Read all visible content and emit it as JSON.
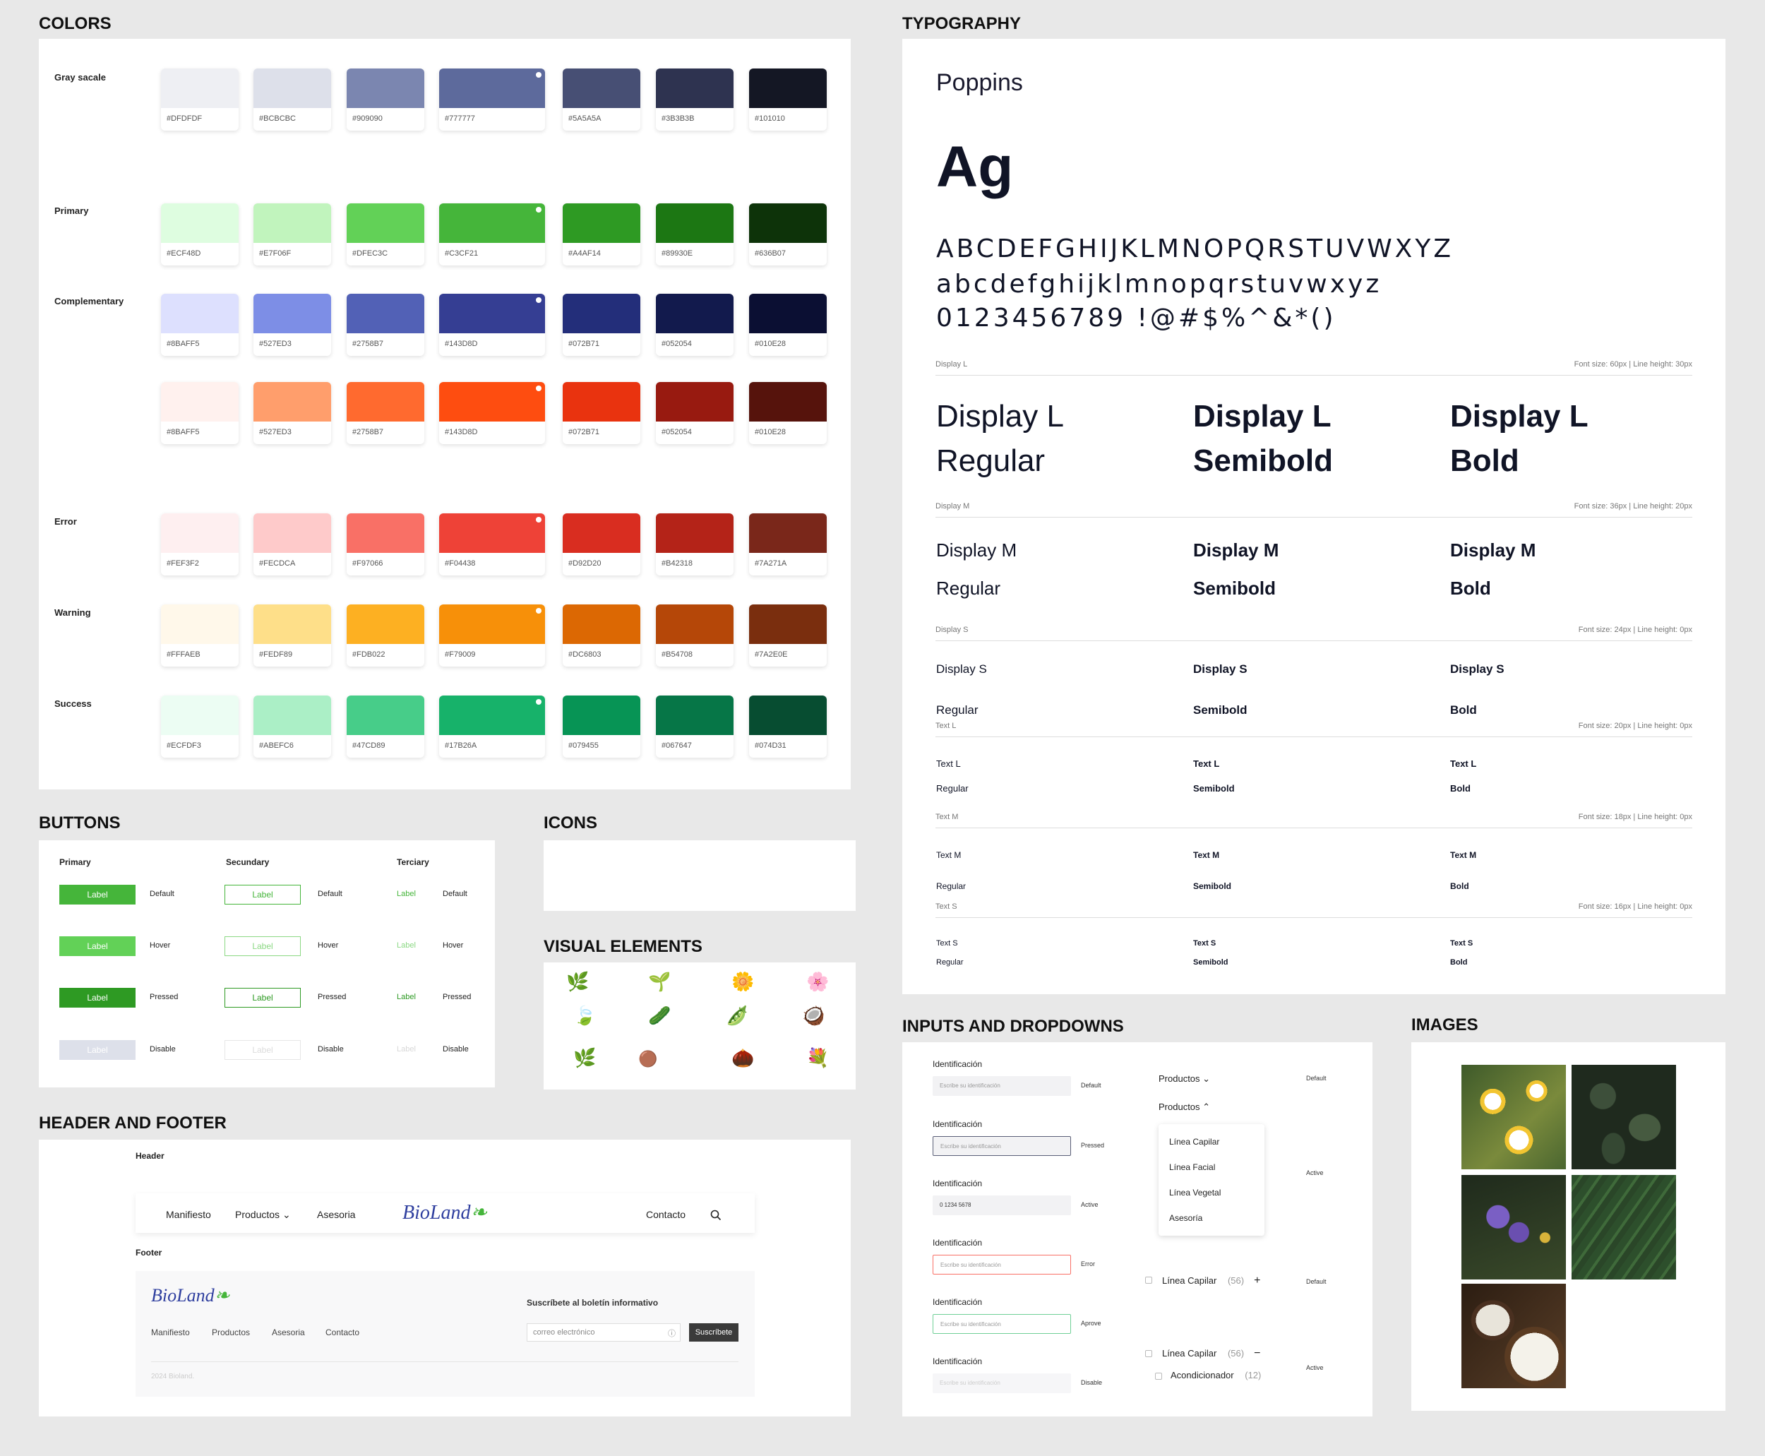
{
  "sections": {
    "colors": "COLORS",
    "typography": "TYPOGRAPHY",
    "buttons": "BUTTONS",
    "icons": "ICONS",
    "visual": "VISUAL ELEMENTS",
    "header_footer": "HEADER AND FOOTER",
    "inputs": "INPUTS AND DROPDOWNS",
    "images": "IMAGES"
  },
  "color_groups": [
    {
      "label": "Gray sacale",
      "swatches": [
        {
          "hex": "#DFDFDF",
          "color": "#eeeff3"
        },
        {
          "hex": "#BCBCBC",
          "color": "#dde0ea"
        },
        {
          "hex": "#909090",
          "color": "#7b86b0"
        },
        {
          "hex": "#777777",
          "color": "#5d6a9c"
        },
        {
          "hex": "#5A5A5A",
          "color": "#474f74"
        },
        {
          "hex": "#3B3B3B",
          "color": "#2e3350"
        },
        {
          "hex": "#101010",
          "color": "#141724"
        }
      ]
    },
    {
      "label": "Primary",
      "swatches": [
        {
          "hex": "#ECF48D",
          "color": "#defde0"
        },
        {
          "hex": "#E7F06F",
          "color": "#c1f4bd"
        },
        {
          "hex": "#DFEC3C",
          "color": "#62d157"
        },
        {
          "hex": "#C3CF21",
          "color": "#45b53a"
        },
        {
          "hex": "#A4AF14",
          "color": "#2e9a23"
        },
        {
          "hex": "#89930E",
          "color": "#1c7713"
        },
        {
          "hex": "#636B07",
          "color": "#0d3309"
        }
      ]
    },
    {
      "label": "Complementary",
      "swatches": [
        {
          "hex": "#8BAFF5",
          "color": "#dde0fe"
        },
        {
          "hex": "#527ED3",
          "color": "#7d8ee6"
        },
        {
          "hex": "#2758B7",
          "color": "#5261b6"
        },
        {
          "hex": "#143D8D",
          "color": "#353e93"
        },
        {
          "hex": "#072B71",
          "color": "#232e7a"
        },
        {
          "hex": "#052054",
          "color": "#121a4d"
        },
        {
          "hex": "#010E28",
          "color": "#0b0f33"
        }
      ]
    },
    {
      "label": "",
      "swatches": [
        {
          "hex": "#8BAFF5",
          "color": "#fff1ee"
        },
        {
          "hex": "#527ED3",
          "color": "#ff9e6c"
        },
        {
          "hex": "#2758B7",
          "color": "#ff6a2f"
        },
        {
          "hex": "#143D8D",
          "color": "#fe4d10"
        },
        {
          "hex": "#072B71",
          "color": "#e9330f"
        },
        {
          "hex": "#052054",
          "color": "#981a10"
        },
        {
          "hex": "#010E28",
          "color": "#56130c"
        }
      ]
    },
    {
      "label": "Error",
      "swatches": [
        {
          "hex": "#FEF3F2",
          "color": "#feeff0"
        },
        {
          "hex": "#FECDCA",
          "color": "#fecaca"
        },
        {
          "hex": "#F97066",
          "color": "#f97066"
        },
        {
          "hex": "#F04438",
          "color": "#ee4237"
        },
        {
          "hex": "#D92D20",
          "color": "#d92d20"
        },
        {
          "hex": "#B42318",
          "color": "#b42318"
        },
        {
          "hex": "#7A271A",
          "color": "#7a271a"
        }
      ]
    },
    {
      "label": "Warning",
      "swatches": [
        {
          "hex": "#FFFAEB",
          "color": "#fff8ea"
        },
        {
          "hex": "#FEDF89",
          "color": "#fedf89"
        },
        {
          "hex": "#FDB022",
          "color": "#fdb022"
        },
        {
          "hex": "#F79009",
          "color": "#f79009"
        },
        {
          "hex": "#DC6803",
          "color": "#dc6803"
        },
        {
          "hex": "#B54708",
          "color": "#b54708"
        },
        {
          "hex": "#7A2E0E",
          "color": "#7a2e0e"
        }
      ]
    },
    {
      "label": "Success",
      "swatches": [
        {
          "hex": "#ECFDF3",
          "color": "#ecfdf3"
        },
        {
          "hex": "#ABEFC6",
          "color": "#abefc6"
        },
        {
          "hex": "#47CD89",
          "color": "#47cd89"
        },
        {
          "hex": "#17B26A",
          "color": "#17b26a"
        },
        {
          "hex": "#079455",
          "color": "#079455"
        },
        {
          "hex": "#067647",
          "color": "#067647"
        },
        {
          "hex": "#074D31",
          "color": "#074d31"
        }
      ]
    }
  ],
  "typography": {
    "font": "Poppins",
    "ag": "Ag",
    "upper": "ABCDEFGHIJKLMNOPQRSTUVWXYZ",
    "lower": "abcdefghijklmnopqrstuvwxyz",
    "nums": "0123456789 !@#$%^&*()",
    "rows": [
      {
        "name": "Display L",
        "spec": "Font size: 60px | Line height: 30px",
        "regular": "Regular",
        "semibold": "Semibold",
        "bold": "Bold"
      },
      {
        "name": "Display M",
        "spec": "Font size: 36px | Line height: 20px",
        "regular": "Regular",
        "semibold": "Semibold",
        "bold": "Bold"
      },
      {
        "name": "Display S",
        "spec": "Font size: 24px | Line height: 0px",
        "regular": "Regular",
        "semibold": "Semibold",
        "bold": "Bold"
      },
      {
        "name": "Text L",
        "spec": "Font size: 20px | Line height: 0px",
        "regular": "Regular",
        "semibold": "Semibold",
        "bold": "Bold"
      },
      {
        "name": "Text M",
        "spec": "Font size: 18px | Line height: 0px",
        "regular": "Regular",
        "semibold": "Semibold",
        "bold": "Bold"
      },
      {
        "name": "Text S",
        "spec": "Font size: 16px | Line height: 0px",
        "regular": "Regular",
        "semibold": "Semibold",
        "bold": "Bold"
      }
    ]
  },
  "buttons": {
    "primary": "Primary",
    "secondary": "Secundary",
    "tertiary": "Terciary",
    "label": "Label",
    "states": [
      "Default",
      "Hover",
      "Pressed",
      "Disable"
    ]
  },
  "icons": [
    "leaf-off-icon",
    "sprout-icon",
    "menu-icon",
    "hourglass-icon",
    "search-icon",
    "chevron-left-icon",
    "chevron-right-icon",
    "chevron-down-icon",
    "chevron-up-icon"
  ],
  "header_footer": {
    "header": "Header",
    "footer": "Footer",
    "nav": [
      "Manifiesto",
      "Productos",
      "Asesoria"
    ],
    "logo": "BioLand",
    "contact": "Contacto",
    "footer_nav": [
      "Manifiesto",
      "Productos",
      "Asesoria",
      "Contacto"
    ],
    "newsletter": "Suscríbete al boletín informativo",
    "email_placeholder": "correo electrónico",
    "subscribe": "Suscríbete",
    "copyright": "2024 Bioland."
  },
  "inputs": {
    "label": "Identificación",
    "placeholder": "Escribe su identificación",
    "active_value": "0 1234 5678",
    "states": [
      "Default",
      "Pressed",
      "Active",
      "Error",
      "Aprove",
      "Disable"
    ],
    "dropdown": "Productos",
    "menu": [
      "Línea Capilar",
      "Línea Facial",
      "Línea Vegetal",
      "Asesoría"
    ],
    "dd_states": [
      "Default",
      "Active",
      "Default",
      "Active"
    ],
    "acc1": {
      "label": "Línea Capilar",
      "count": "(56)"
    },
    "acc2": {
      "label": "Línea Capilar",
      "count": "(56)"
    },
    "acc_child": {
      "label": "Acondicionador",
      "count": "(12)"
    }
  }
}
